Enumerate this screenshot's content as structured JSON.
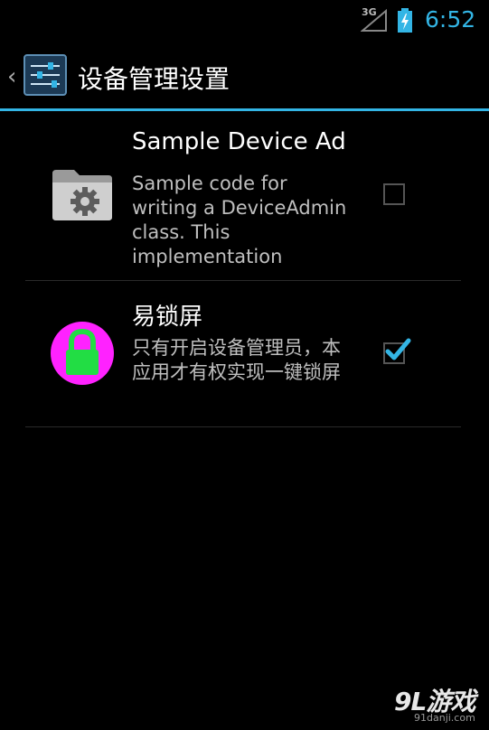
{
  "status_bar": {
    "network_label": "3G",
    "time": "6:52",
    "accent_color": "#33b5e5"
  },
  "action_bar": {
    "title": "设备管理设置",
    "icon": "settings-sliders-icon"
  },
  "admins": [
    {
      "title": "Sample Device Ad",
      "summary": "Sample code for writing a DeviceAdmin class. This implementation",
      "icon": "folder-gear-icon",
      "checked": false
    },
    {
      "title": "易锁屏",
      "summary": "只有开启设备管理员，本应用才有权实现一键锁屏",
      "icon": "lock-icon",
      "checked": true,
      "icon_bg_color": "#ff22ff",
      "icon_fg_color": "#22dd44"
    }
  ],
  "watermark": {
    "logo": "9L游戏",
    "url": "91danji.com"
  }
}
